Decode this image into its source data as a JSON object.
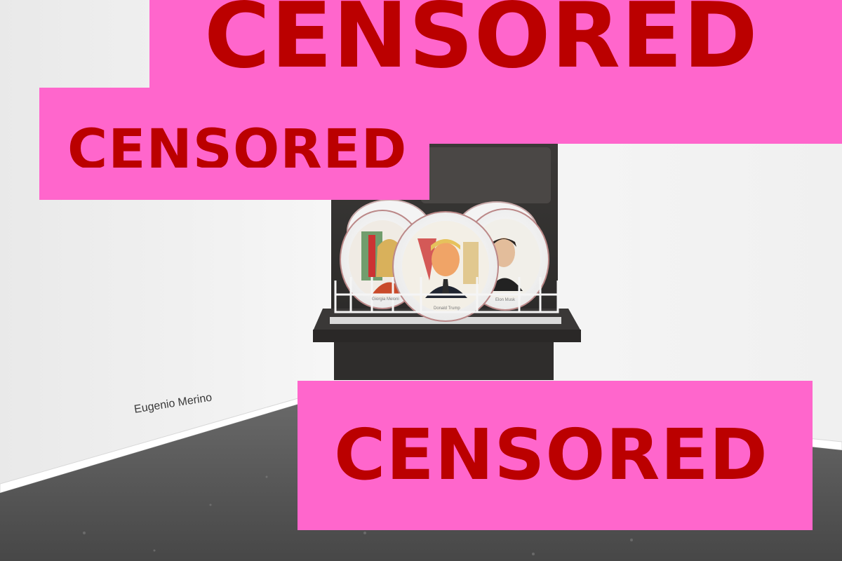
{
  "photo": {
    "description_alt": "Art installation photo",
    "wall_credit": "Eugenio Merino",
    "plate_captions": [
      "Giorgia Meloni",
      "Donald Trump",
      "Elon Musk"
    ]
  },
  "banners": [
    {
      "id": "top",
      "text": "CENSORED"
    },
    {
      "id": "middle-left",
      "text": "CENSORED"
    },
    {
      "id": "bottom",
      "text": "CENSORED"
    }
  ],
  "colors": {
    "banner_bg": "#ff66cc",
    "banner_text": "#bb0000",
    "wall": "#efefef",
    "floor": "#5b5b5b",
    "dishwasher": "#2f2d2c"
  }
}
